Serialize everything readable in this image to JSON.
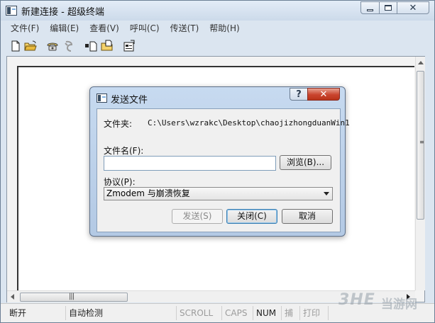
{
  "window": {
    "title": "新建连接 - 超级终端",
    "close_glyph": "✕"
  },
  "menu": [
    {
      "label": "文件(F)"
    },
    {
      "label": "编辑(E)"
    },
    {
      "label": "查看(V)"
    },
    {
      "label": "呼叫(C)"
    },
    {
      "label": "传送(T)"
    },
    {
      "label": "帮助(H)"
    }
  ],
  "toolbar": {
    "icons": [
      "new-file-icon",
      "open-folder-icon",
      "phone-connect-icon",
      "disconnect-icon",
      "send-file-icon",
      "receive-file-icon",
      "properties-icon"
    ]
  },
  "dialog": {
    "title": "发送文件",
    "help_glyph": "?",
    "close_glyph": "✕",
    "folder_label": "文件夹:",
    "folder_path": "C:\\Users\\wzrakc\\Desktop\\chaojizhongduanWin1",
    "filename_label": "文件名(F):",
    "filename_value": "",
    "browse_button": "浏览(B)...",
    "protocol_label": "协议(P):",
    "protocol_selected": "Zmodem 与崩溃恢复",
    "send_button": "发送(S)",
    "close_button": "关闭(C)",
    "cancel_button": "取消"
  },
  "statusbar": {
    "connection": "断开",
    "detect": "自动检测",
    "scroll": "SCROLL",
    "caps": "CAPS",
    "num": "NUM",
    "capture": "捕",
    "print": "打印"
  },
  "scrollbar": {
    "h_grip": "|||",
    "v_grip": "≡"
  },
  "watermark": {
    "brand": "3HE",
    "site": "当游网"
  },
  "colors": {
    "titlebar": "#d6e2f0",
    "dialog_frame": "#bcd0e8",
    "close_red": "#c9442d",
    "disabled_text": "#9c9c9c"
  }
}
